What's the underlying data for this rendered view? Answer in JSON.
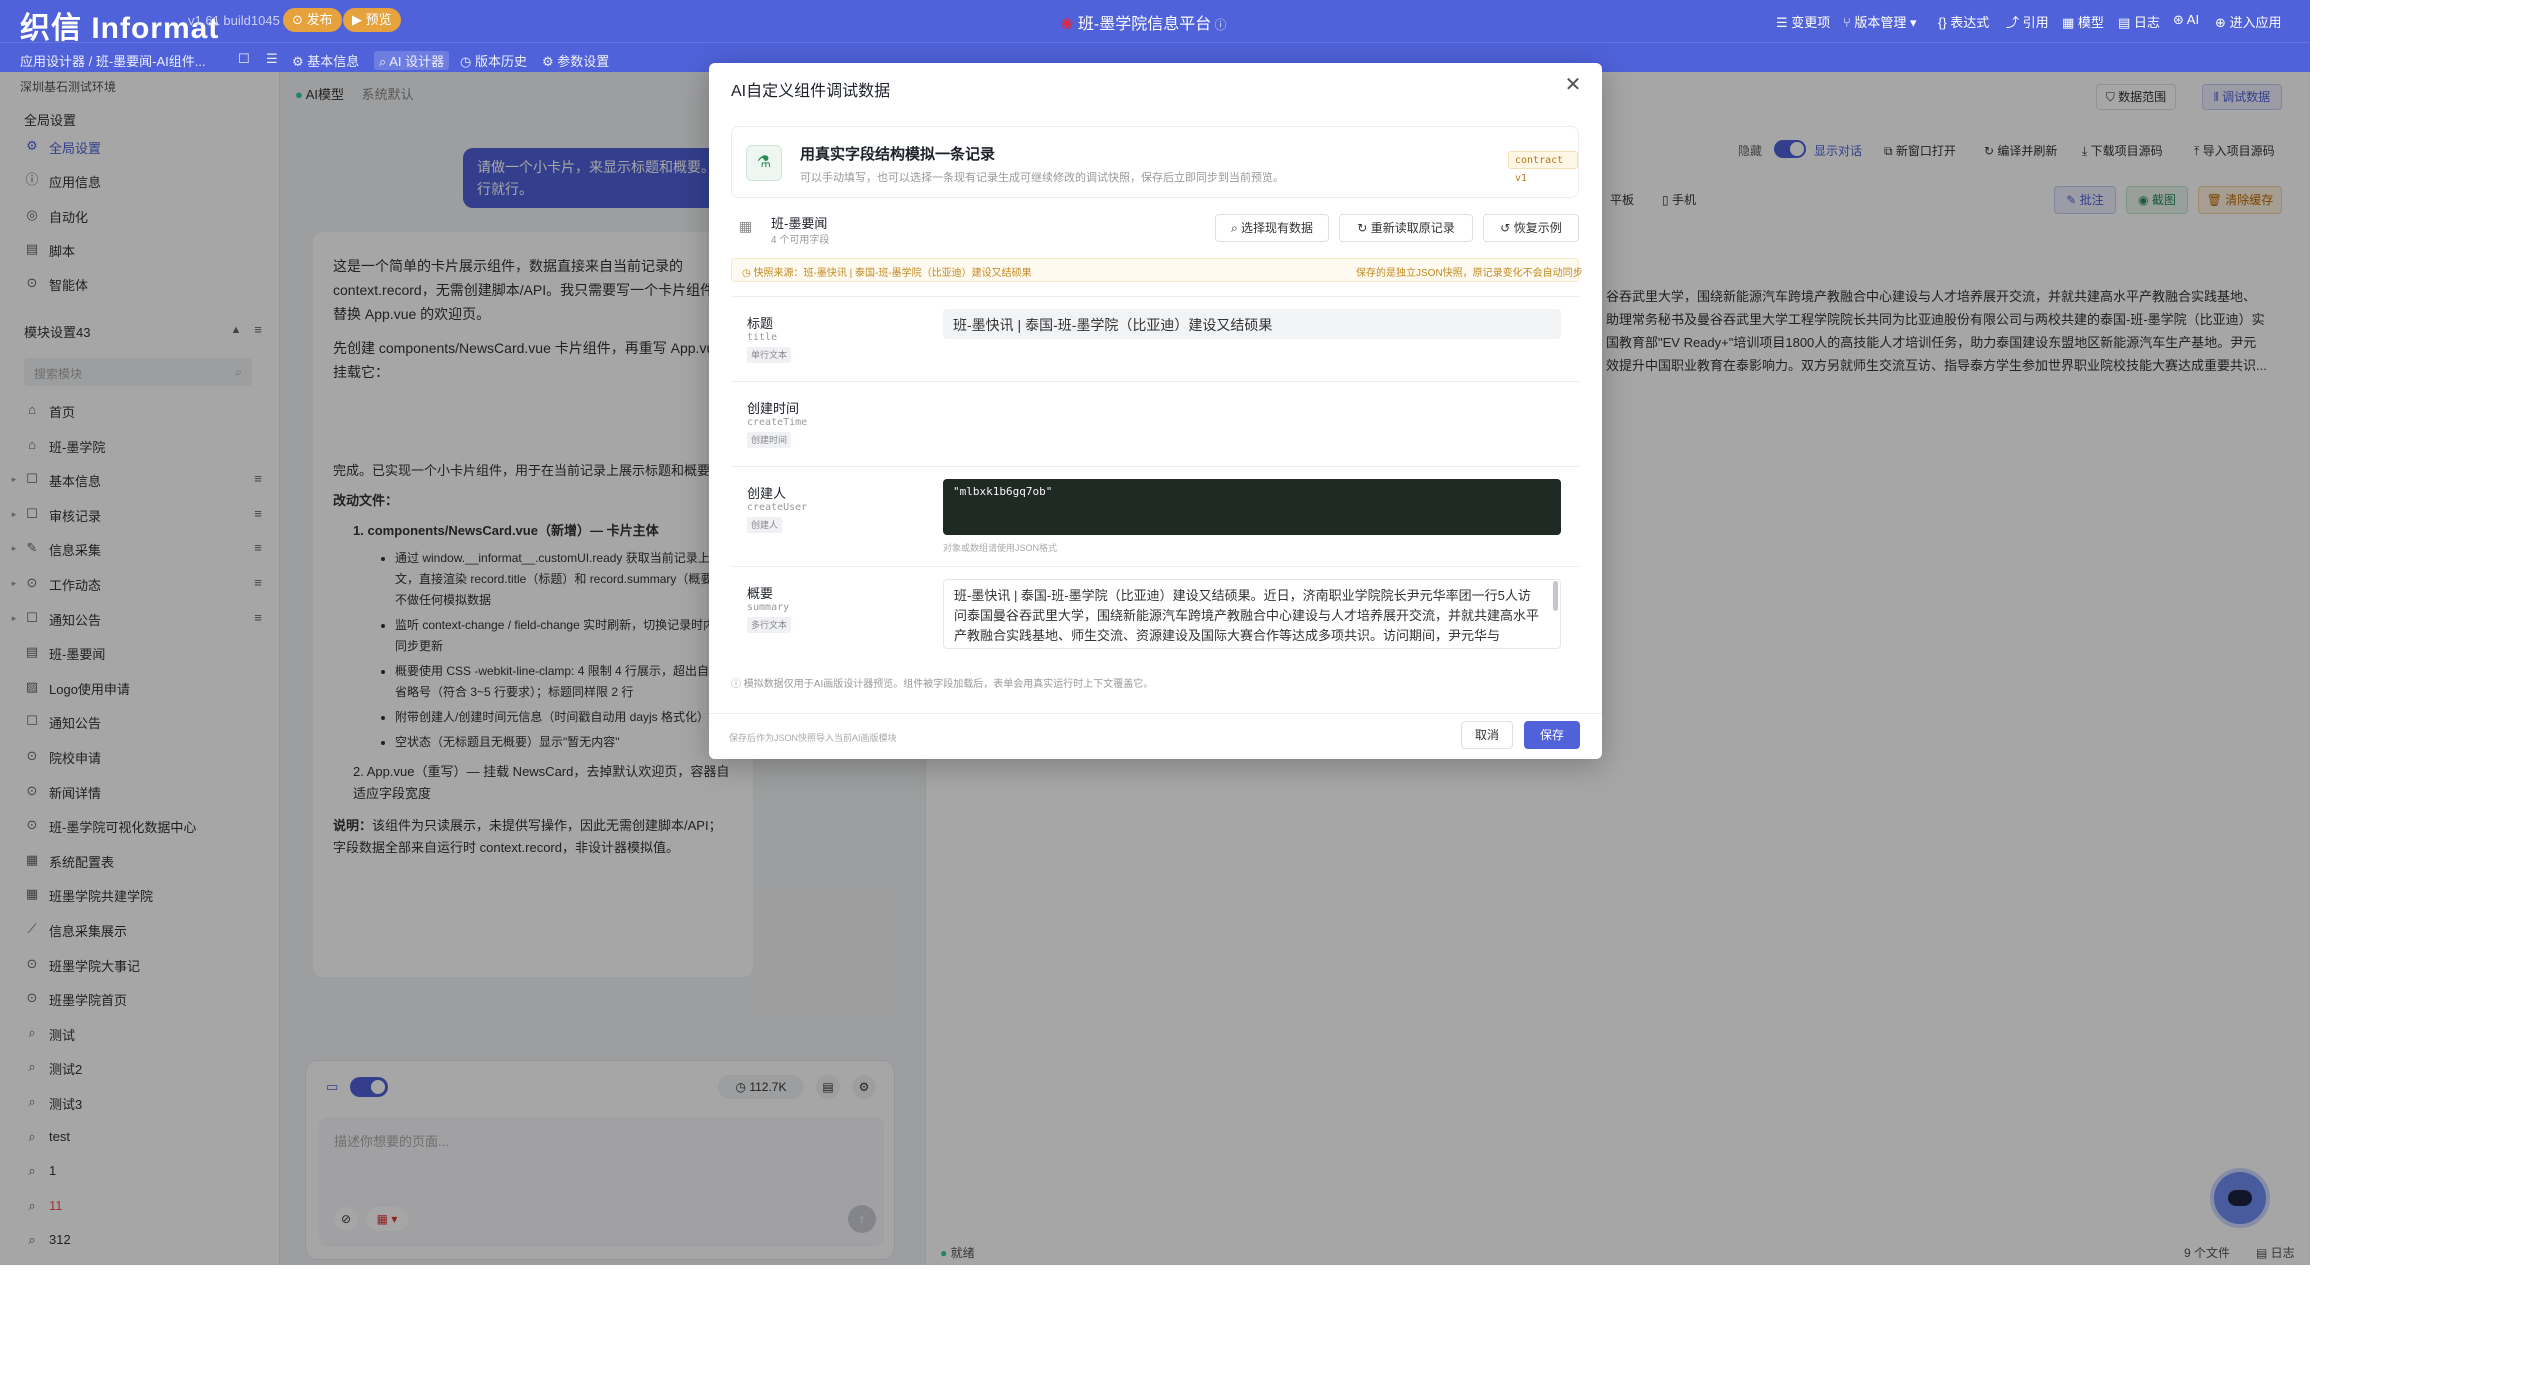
{
  "topbar": {
    "logo": "织信 Informat",
    "version": "v1.61 build1045",
    "publish": "发布",
    "preview": "预览",
    "title": "班-墨学院信息平台",
    "right_items": [
      "变更项",
      "版本管理",
      "表达式",
      "引用",
      "模型",
      "日志",
      "AI",
      "进入应用"
    ]
  },
  "subbar": {
    "breadcrumb": "应用设计器 / 班-墨要闻-AI组件...",
    "tabs": [
      "基本信息",
      "AI 设计器",
      "版本历史",
      "参数设置"
    ]
  },
  "sidebar": {
    "env": "深圳基石测试环境",
    "global_title": "全局设置",
    "global_items": [
      "全局设置",
      "应用信息",
      "自动化",
      "脚本",
      "智能体"
    ],
    "modules_title": "模块设置43",
    "search_placeholder": "搜索模块",
    "modules": [
      "首页",
      "班-墨学院",
      "基本信息",
      "审核记录",
      "信息采集",
      "工作动态",
      "通知公告",
      "班-墨要闻",
      "Logo使用申请",
      "通知公告",
      "院校申请",
      "新闻详情",
      "班-墨学院可视化数据中心",
      "系统配置表",
      "班墨学院共建学院",
      "信息采集展示",
      "班墨学院大事记",
      "班墨学院首页",
      "测试",
      "测试2",
      "测试3",
      "test",
      "1",
      "11",
      "312"
    ]
  },
  "chat": {
    "model_label": "AI模型",
    "model_value": "系统默认",
    "user_msg": "请做一个小卡片，来显示标题和概要。也许行就行。",
    "reply1_p1": "这是一个简单的卡片展示组件，数据直接来自当前记录的 context.record，无需创建脚本/API。我只需要写一个卡片组件，替换 App.vue 的欢迎页。",
    "reply1_p2": "先创建 components/NewsCard.vue 卡片组件，再重写 App.vue 挂载它：",
    "reply2_intro": "完成。已实现一个小卡片组件，用于在当前记录上展示标题和概要。",
    "reply2_changed": "改动文件：",
    "item1_title": "components/NewsCard.vue（新增）— 卡片主体",
    "item1_bullets": [
      "通过 window.__informat__.customUI.ready 获取当前记录上下文，直接渲染 record.title（标题）和 record.summary（概要），不做任何模拟数据",
      "监听 context-change / field-change 实时刷新，切换记录时内容同步更新",
      "概要使用 CSS -webkit-line-clamp: 4 限制 4 行展示，超出自动省略号（符合 3~5 行要求）；标题同样限 2 行",
      "附带创建人/创建时间元信息（时间戳自动用 dayjs 格式化）",
      "空状态（无标题且无概要）显示\"暂无内容\""
    ],
    "item2_title": "App.vue（重写）— 挂载 NewsCard，去掉默认欢迎页，容器自适应字段宽度",
    "note_label": "说明：",
    "note_text": "该组件为只读展示，未提供写操作，因此无需创建脚本/API；字段数据全部来自运行时 context.record，非设计器模拟值。",
    "input_placeholder": "描述你想要的页面...",
    "token_count": "112.7K"
  },
  "preview": {
    "top_buttons": [
      "数据范围",
      "调试数据"
    ],
    "hide_label": "隐藏",
    "show_dialog": "显示对话",
    "actions": [
      "新窗口打开",
      "编译并刷新",
      "下载项目源码",
      "导入项目源码"
    ],
    "devices": [
      "平板",
      "手机"
    ],
    "tools": [
      "批注",
      "截图",
      "清除缓存"
    ],
    "content_lines": [
      "谷吞武里大学，围绕新能源汽车跨境产教融合中心建设与人才培养展开交流，并就共建高水平产教融合实践基地、",
      "助理常务秘书及曼谷吞武里大学工程学院院长共同为比亚迪股份有限公司与两校共建的泰国-班-墨学院（比亚迪）实",
      "国教育部\"EV Ready+\"培训项目1800人的高技能人才培训任务，助力泰国建设东盟地区新能源汽车生产基地。尹元",
      "效提升中国职业教育在泰影响力。双方另就师生交流互访、指导泰方学生参加世界职业院校技能大赛达成重要共识..."
    ],
    "status": "就绪",
    "file_count": "9 个文件",
    "log": "日志"
  },
  "modal": {
    "title": "AI自定义组件调试数据",
    "card_title": "用真实字段结构模拟一条记录",
    "card_desc": "可以手动填写，也可以选择一条现有记录生成可继续修改的调试快照，保存后立即同步到当前预览。",
    "contract": "contract v1",
    "table_name": "班-墨要闻",
    "field_count": "4 个可用字段",
    "btn_select": "选择现有数据",
    "btn_reload": "重新读取原记录",
    "btn_restore": "恢复示例",
    "source_label": "快照来源：班-墨快讯 | 泰国-班-墨学院（比亚迪）建设又结硕果",
    "source_note": "保存的是独立JSON快照，原记录变化不会自动同步",
    "fields": [
      {
        "label": "标题",
        "key": "title",
        "tag": "单行文本",
        "value": "班-墨快讯 | 泰国-班-墨学院（比亚迪）建设又结硕果"
      },
      {
        "label": "创建时间",
        "key": "createTime",
        "tag": "创建时间",
        "value": ""
      },
      {
        "label": "创建人",
        "key": "createUser",
        "tag": "创建人",
        "value": "\"mlbxk1b6gq7ob\"",
        "hint": "对象或数组请使用JSON格式"
      },
      {
        "label": "概要",
        "key": "summary",
        "tag": "多行文本",
        "value": "班-墨快讯 | 泰国-班-墨学院（比亚迪）建设又结硕果。近日，济南职业学院院长尹元华率团一行5人访问泰国曼谷吞武里大学，围绕新能源汽车跨境产教融合中心建设与人才培养展开交流，并就共建高水平产教融合实践基地、师生交流、资源建设及国际大赛合作等达成多项共识。访问期间，尹元华与"
      }
    ],
    "footer_note": "模拟数据仅用于AI画版设计器预览。组件被字段加载后，表单会用真实运行时上下文覆盖它。",
    "bottom_note": "保存后作为JSON快照导入当前AI画版模块",
    "cancel": "取消",
    "save": "保存"
  },
  "colors": {
    "brand": "#4f62d9",
    "orange": "#f0a020",
    "dark": "#1f2a25"
  }
}
